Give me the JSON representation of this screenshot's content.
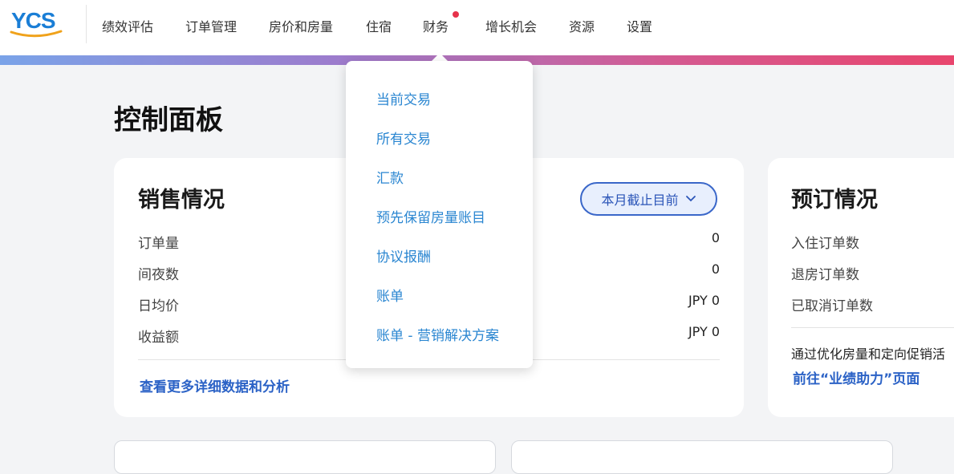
{
  "logo": {
    "text": "YCS"
  },
  "nav": {
    "items": [
      {
        "label": "绩效评估"
      },
      {
        "label": "订单管理"
      },
      {
        "label": "房价和房量"
      },
      {
        "label": "住宿"
      },
      {
        "label": "财务",
        "has_notification": true
      },
      {
        "label": "增长机会"
      },
      {
        "label": "资源"
      },
      {
        "label": "设置"
      }
    ]
  },
  "finance_menu": {
    "items": [
      {
        "label": "当前交易"
      },
      {
        "label": "所有交易"
      },
      {
        "label": "汇款"
      },
      {
        "label": "预先保留房量账目"
      },
      {
        "label": "协议报酬"
      },
      {
        "label": "账单"
      },
      {
        "label": "账单 - 营销解决方案"
      }
    ]
  },
  "page": {
    "title": "控制面板"
  },
  "sales": {
    "title": "销售情况",
    "period_label": "本月截止目前",
    "rows": [
      {
        "label": "订单量",
        "value": "0"
      },
      {
        "label": "间夜数",
        "value": "0"
      },
      {
        "label": "日均价",
        "value": "JPY 0"
      },
      {
        "label": "收益额",
        "value": "JPY 0"
      }
    ],
    "details_link": "查看更多详细数据和分析"
  },
  "booking": {
    "title": "预订情况",
    "rows": [
      {
        "label": "入住订单数"
      },
      {
        "label": "退房订单数"
      },
      {
        "label": "已取消订单数"
      }
    ],
    "promo_text": "通过优化房量和定向促销活",
    "promo_link": "前往“业绩助力”页面"
  },
  "colors": {
    "accent": "#2b62c6",
    "menu_link": "#2a86d1",
    "notification": "#e6324b",
    "gradient_start": "#7aa3e8",
    "gradient_end": "#e8456d"
  }
}
